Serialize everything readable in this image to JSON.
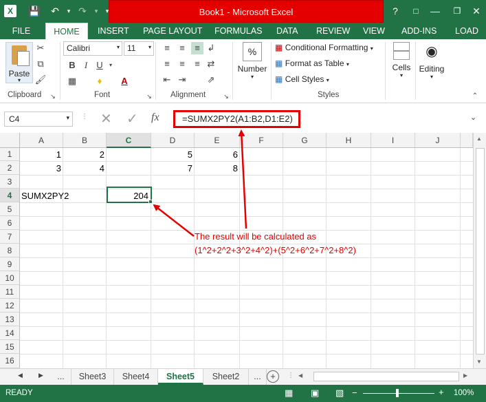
{
  "window": {
    "title": "Book1 - Microsoft Excel",
    "help": "?",
    "minimize": "—",
    "close": "✕"
  },
  "tabs": [
    "FILE",
    "HOME",
    "INSERT",
    "PAGE LAYOUT",
    "FORMULAS",
    "DATA",
    "REVIEW",
    "VIEW",
    "ADD-INS",
    "LOAD"
  ],
  "ribbon": {
    "clipboard": {
      "paste": "Paste",
      "label": "Clipboard"
    },
    "font": {
      "name": "Calibri",
      "size": "11",
      "label": "Font",
      "bold": "B",
      "italic": "I",
      "underline": "U"
    },
    "alignment": {
      "label": "Alignment"
    },
    "number": {
      "button": "Number",
      "percent": "%"
    },
    "styles": {
      "cond": "Conditional Formatting",
      "table": "Format as Table",
      "cell": "Cell Styles",
      "label": "Styles"
    },
    "cells": {
      "button": "Cells"
    },
    "editing": {
      "button": "Editing"
    }
  },
  "formula_bar": {
    "name_box": "C4",
    "fx": "fx",
    "formula": "=SUMX2PY2(A1:B2,D1:E2)"
  },
  "grid": {
    "columns": [
      "A",
      "B",
      "C",
      "D",
      "E",
      "F",
      "G",
      "H",
      "I",
      "J"
    ],
    "rows": [
      "1",
      "2",
      "3",
      "4",
      "5",
      "6",
      "7",
      "8",
      "9",
      "10",
      "11",
      "12",
      "13",
      "14",
      "15",
      "16"
    ],
    "cells": {
      "A1": "1",
      "B1": "2",
      "D1": "5",
      "E1": "6",
      "A2": "3",
      "B2": "4",
      "D2": "7",
      "E2": "8",
      "A4": "SUMX2PY2",
      "C4": "204"
    }
  },
  "annotation": {
    "line1": "The result will be calculated as",
    "line2": "(1^2+2^2+3^2+4^2)+(5^2+6^2+7^2+8^2)"
  },
  "sheets": [
    "...",
    "Sheet3",
    "Sheet4",
    "Sheet5",
    "Sheet2",
    "..."
  ],
  "active_sheet": "Sheet5",
  "status": {
    "ready": "READY",
    "zoom": "100%"
  },
  "colors": {
    "excel_green": "#217346",
    "highlight_red": "#e50000"
  }
}
